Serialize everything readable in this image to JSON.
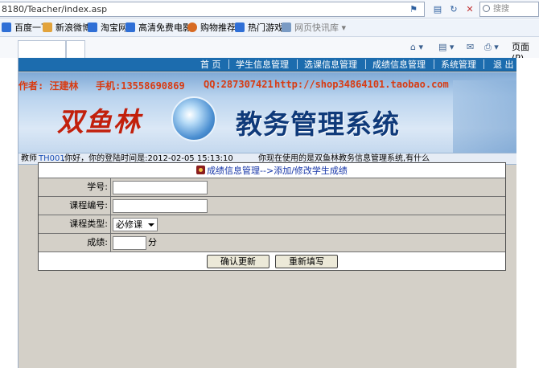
{
  "browser": {
    "address": "8180/Teacher/index.asp",
    "search_placeholder": "搜搜",
    "favorites": [
      {
        "label": "百度一下",
        "icon": "baidu-icon",
        "color": "#2f6fd6"
      },
      {
        "label": "新浪微博",
        "icon": "weibo-icon",
        "color": "#e2a33c"
      },
      {
        "label": "淘宝网",
        "icon": "taobao-icon",
        "color": "#2f6fd6"
      },
      {
        "label": "高清免费电影",
        "icon": "movie-icon",
        "color": "#2f6fd6"
      },
      {
        "label": "购物推荐",
        "icon": "shopping-icon",
        "color": "#d76a22"
      },
      {
        "label": "热门游戏",
        "icon": "games-icon",
        "color": "#2f6fd6"
      },
      {
        "label": "网页快讯库",
        "icon": "web-slice-icon",
        "color": "#7a9bc4"
      }
    ],
    "page_menu_label": "页面(P)"
  },
  "nav": {
    "items": [
      "首 页",
      "学生信息管理",
      "选课信息管理",
      "成绩信息管理",
      "系统管理",
      "退 出"
    ]
  },
  "banner": {
    "author": "作者: 汪建林",
    "phone": "手机:13558690869",
    "qq": "QQ:287307421",
    "url": "http://shop34864101.taobao.com",
    "brand": "双鱼林",
    "title": "教务管理系统"
  },
  "status": {
    "teacher_prefix": "教师",
    "teacher_id": "TH001",
    "greeting": ",你好，你的登陆时间是:2012-02-05 15:13:10",
    "marquee": "你现在使用的是双鱼林教务信息管理系统,有什么"
  },
  "form": {
    "header": "成绩信息管理-->添加/修改学生成绩",
    "fields": {
      "student_no": {
        "label": "学号:",
        "value": ""
      },
      "course_no": {
        "label": "课程编号:",
        "value": ""
      },
      "course_type": {
        "label": "课程类型:",
        "value": "必修课"
      },
      "score": {
        "label": "成绩:",
        "value": "",
        "unit": "分"
      }
    },
    "buttons": {
      "confirm": "确认更新",
      "reset": "重新填写"
    }
  }
}
